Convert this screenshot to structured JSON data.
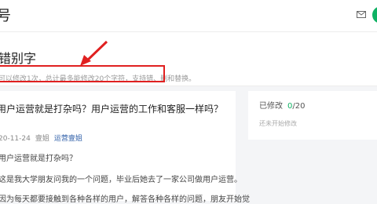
{
  "header": {
    "app_title": "号"
  },
  "page": {
    "title": "错别字",
    "hint": "可以修改1次，总计最多能修改20个字符，支持错、删和替换。"
  },
  "article": {
    "title": "用户运营就是打杂吗？用户运营的工作和客服一样吗？",
    "date": "20-11-24",
    "author": "壹姐",
    "tag": "运营壹姐",
    "lines": [
      "用户运营就是打杂吗？",
      "这是我大学朋友问我的一个问题，毕业后她去了一家公司做用户运营。",
      "因为每天都要接触到各种各样的用户，解答各种各样的问题，朋友开始觉"
    ]
  },
  "sidebar": {
    "modified_label": "已修改",
    "modified_count": "0",
    "modified_total": "/20",
    "status": "还未开始修改"
  },
  "colors": {
    "accent_green": "#0fb264",
    "annotation_red": "#e02020",
    "tag_blue": "#2f5fa8"
  },
  "icons": [
    "mail-icon",
    "avatar"
  ]
}
